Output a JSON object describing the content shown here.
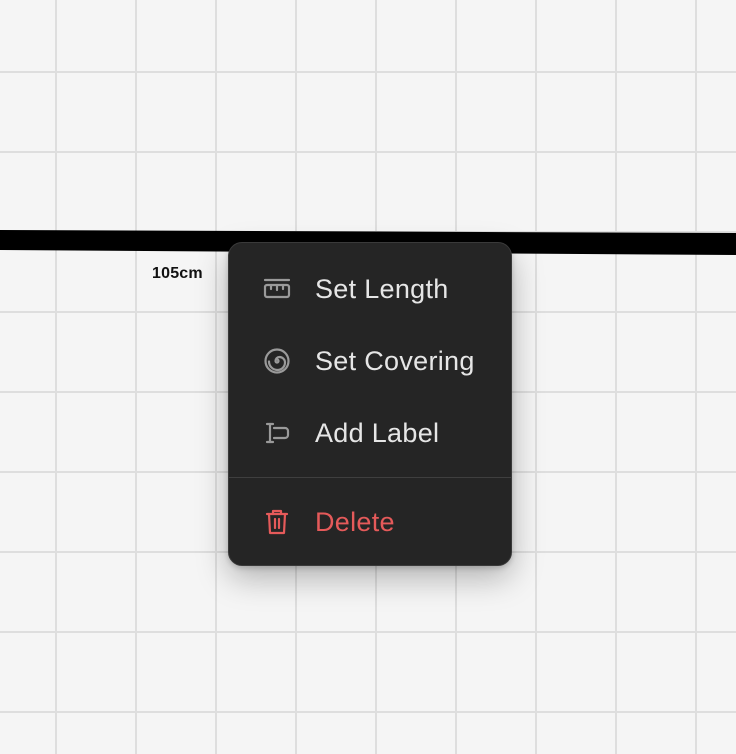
{
  "canvas": {
    "dimension_label": "105cm"
  },
  "context_menu": {
    "items": [
      {
        "label": "Set Length",
        "icon": "ruler-icon"
      },
      {
        "label": "Set Covering",
        "icon": "spiral-icon"
      },
      {
        "label": "Add Label",
        "icon": "text-cursor-icon"
      }
    ],
    "danger_item": {
      "label": "Delete",
      "icon": "trash-icon"
    }
  },
  "colors": {
    "background": "#f5f5f5",
    "grid": "#dedede",
    "menu_background": "#252525",
    "menu_text": "#e6e6e6",
    "icon": "#9a9a9a",
    "danger": "#e55a5a",
    "wall": "#000000"
  }
}
